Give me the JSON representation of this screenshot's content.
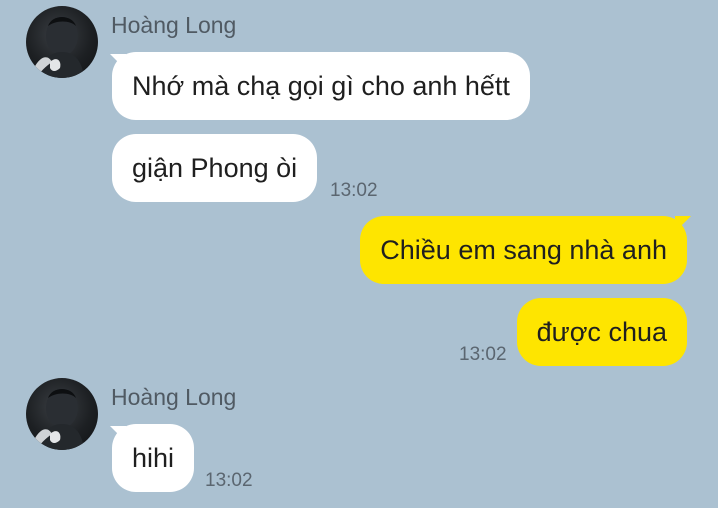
{
  "messages": [
    {
      "sender": "Hoàng Long",
      "avatar_icon": "profile-photo",
      "bubbles": [
        {
          "text": "Nhớ mà chạ gọi gì cho anh hếtt"
        },
        {
          "text": "giận Phong òi",
          "time": "13:02"
        }
      ]
    },
    {
      "sender": "me",
      "bubbles": [
        {
          "text": "Chiều em sang nhà anh"
        },
        {
          "text": "được chua",
          "time": "13:02"
        }
      ]
    },
    {
      "sender": "Hoàng Long",
      "avatar_icon": "profile-photo",
      "bubbles": [
        {
          "text": "hihi",
          "time": "13:02"
        }
      ]
    }
  ],
  "colors": {
    "background": "#abc1d1",
    "incoming_bubble": "#ffffff",
    "outgoing_bubble": "#fee500",
    "timestamp": "#5b6670",
    "sender_name": "#505a63"
  }
}
